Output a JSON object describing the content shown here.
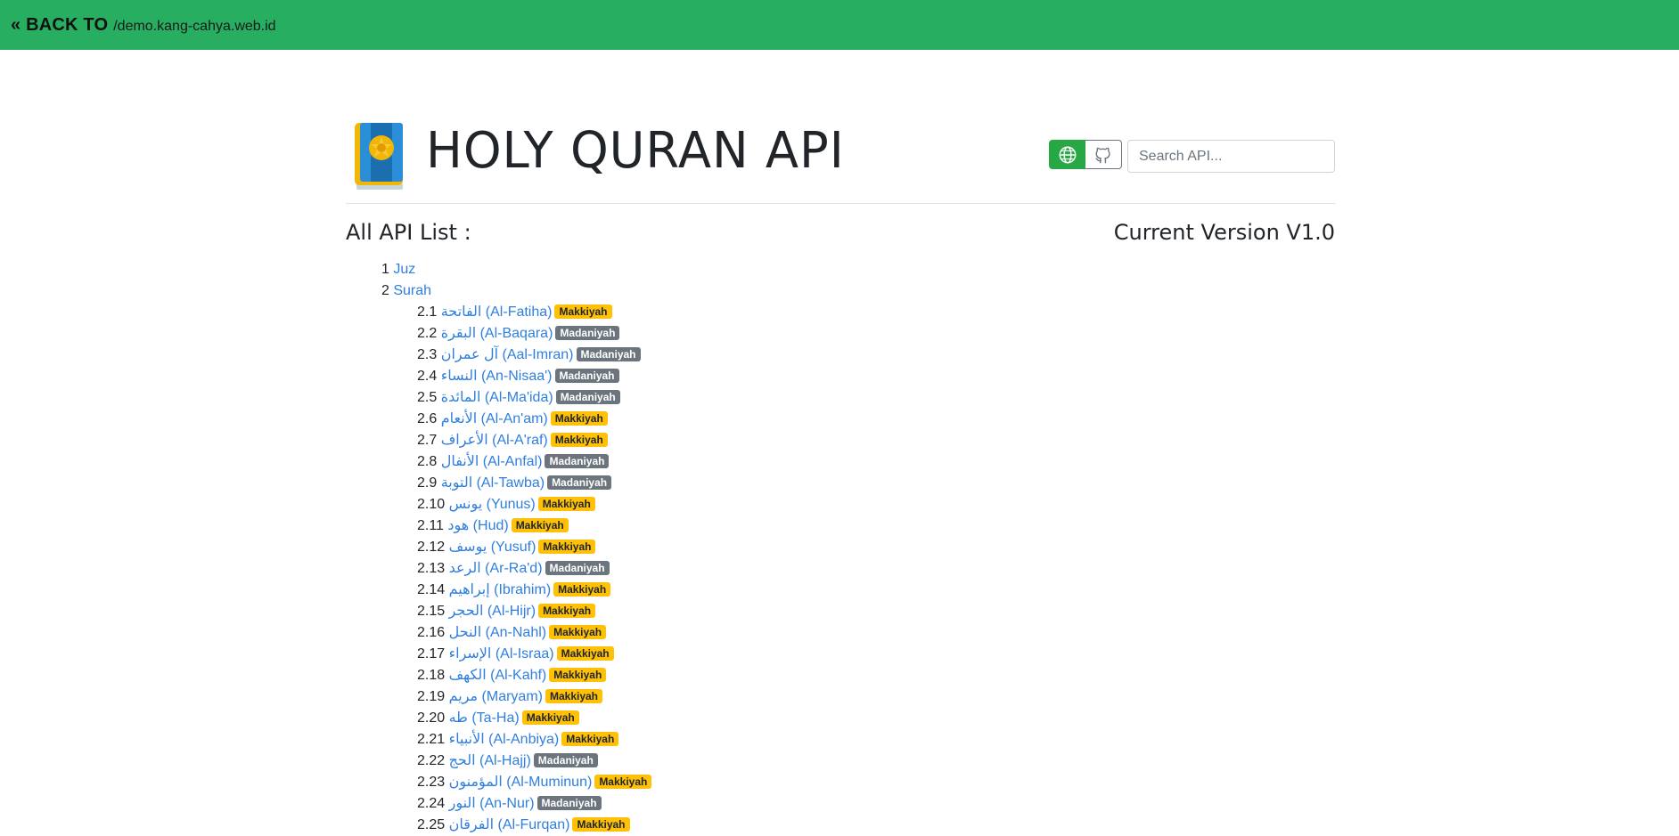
{
  "topbar": {
    "back_label": "« BACK TO",
    "back_url": "/demo.kang-cahya.web.id"
  },
  "header": {
    "title": "HOLY QURAN API",
    "logo_icon": "quran-book-icon",
    "web_button_icon": "globe-icon",
    "github_button_icon": "github-icon",
    "search_placeholder": "Search API...",
    "search_value": ""
  },
  "list": {
    "title": "All API List :",
    "version": "Current Version V1.0",
    "items": [
      {
        "num": "1",
        "label": "Juz"
      },
      {
        "num": "2",
        "label": "Surah"
      }
    ],
    "surah": [
      {
        "num": "2.1",
        "label": "الفاتحة (Al-Fatiha)",
        "type": "Makkiyah"
      },
      {
        "num": "2.2",
        "label": "البقرة (Al-Baqara)",
        "type": "Madaniyah"
      },
      {
        "num": "2.3",
        "label": "آل عمران (Aal-Imran)",
        "type": "Madaniyah"
      },
      {
        "num": "2.4",
        "label": "النساء (An-Nisaa')",
        "type": "Madaniyah"
      },
      {
        "num": "2.5",
        "label": "المائدة (Al-Ma'ida)",
        "type": "Madaniyah"
      },
      {
        "num": "2.6",
        "label": "الأنعام (Al-An'am)",
        "type": "Makkiyah"
      },
      {
        "num": "2.7",
        "label": "الأعراف (Al-A'raf)",
        "type": "Makkiyah"
      },
      {
        "num": "2.8",
        "label": "الأنفال (Al-Anfal)",
        "type": "Madaniyah"
      },
      {
        "num": "2.9",
        "label": "التوبة (Al-Tawba)",
        "type": "Madaniyah"
      },
      {
        "num": "2.10",
        "label": "يونس (Yunus)",
        "type": "Makkiyah"
      },
      {
        "num": "2.11",
        "label": "هود (Hud)",
        "type": "Makkiyah"
      },
      {
        "num": "2.12",
        "label": "يوسف (Yusuf)",
        "type": "Makkiyah"
      },
      {
        "num": "2.13",
        "label": "الرعد (Ar-Ra'd)",
        "type": "Madaniyah"
      },
      {
        "num": "2.14",
        "label": "إبراهيم (Ibrahim)",
        "type": "Makkiyah"
      },
      {
        "num": "2.15",
        "label": "الحجر (Al-Hijr)",
        "type": "Makkiyah"
      },
      {
        "num": "2.16",
        "label": "النحل (An-Nahl)",
        "type": "Makkiyah"
      },
      {
        "num": "2.17",
        "label": "الإسراء (Al-Israa)",
        "type": "Makkiyah"
      },
      {
        "num": "2.18",
        "label": "الكهف (Al-Kahf)",
        "type": "Makkiyah"
      },
      {
        "num": "2.19",
        "label": "مريم (Maryam)",
        "type": "Makkiyah"
      },
      {
        "num": "2.20",
        "label": "طه (Ta-Ha)",
        "type": "Makkiyah"
      },
      {
        "num": "2.21",
        "label": "الأنبياء (Al-Anbiya)",
        "type": "Makkiyah"
      },
      {
        "num": "2.22",
        "label": "الحج (Al-Hajj)",
        "type": "Madaniyah"
      },
      {
        "num": "2.23",
        "label": "المؤمنون (Al-Muminun)",
        "type": "Makkiyah"
      },
      {
        "num": "2.24",
        "label": "النور (An-Nur)",
        "type": "Madaniyah"
      },
      {
        "num": "2.25",
        "label": "الفرقان (Al-Furqan)",
        "type": "Makkiyah"
      }
    ]
  },
  "colors": {
    "topbar": "#28ae60",
    "link": "#2f7fe0",
    "makkiyah": "#ffc107",
    "madaniyah": "#6c757d"
  }
}
